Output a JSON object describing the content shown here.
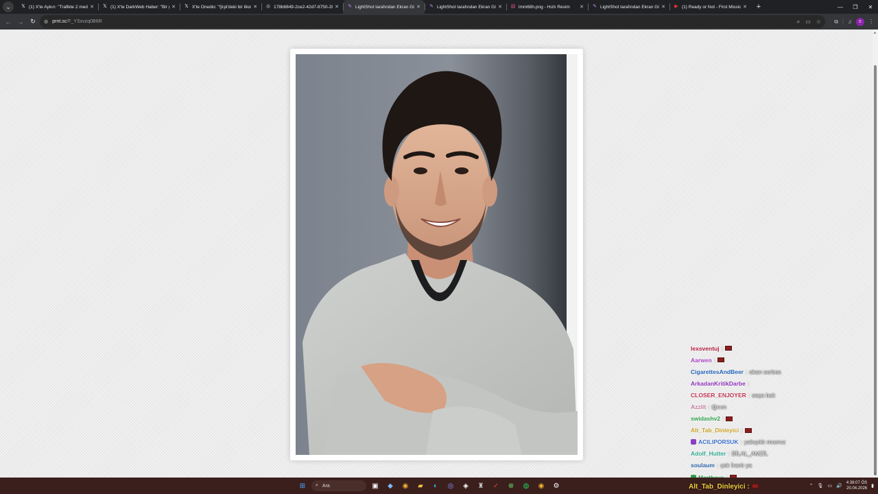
{
  "tabs": [
    {
      "title": "(1) X'te Aykırı: \"Trafikte 2 meden",
      "icon": "x"
    },
    {
      "title": "(1) X'te DarkWeb Haber: \"Bir gü",
      "icon": "x"
    },
    {
      "title": "X'te Onedio: \"Şişli'deki bir ilkok",
      "icon": "x"
    },
    {
      "title": "178b6849-2ce2-42d7-8750-28",
      "icon": "globe"
    },
    {
      "title": "LightShot tarafından Ekran Gö",
      "icon": "feather",
      "active": true
    },
    {
      "title": "LightShot tarafından Ekran Gö",
      "icon": "feather"
    },
    {
      "title": "lmm68h.png - Hızlı Resim",
      "icon": "image"
    },
    {
      "title": "LightShot tarafından Ekran Gö",
      "icon": "feather"
    },
    {
      "title": "(1) Ready or Not - First Mission",
      "icon": "youtube"
    }
  ],
  "address": {
    "host": "prnt.sc",
    "path": "/F_YSxvzq0B6R"
  },
  "chat": [
    {
      "user": "lexsventuj",
      "color": "#b0183b",
      "sep": ":",
      "msg": "",
      "flag": true
    },
    {
      "user": "Aarwen",
      "color": "#a83fc4",
      "sep": ":",
      "msg": "",
      "flag": true
    },
    {
      "user": "CigarettesAndBeer",
      "color": "#1f5fb5",
      "sep": ":",
      "msg": "okan serbes",
      "flag": false
    },
    {
      "user": "ArkadanKritikDarbe",
      "color": "#8a2fb8",
      "sep": ":",
      "msg": "",
      "flag": false
    },
    {
      "user": "CLOSER_ENJOYER",
      "color": "#c0304e",
      "sep": ":",
      "msg": "saça bak",
      "flag": false
    },
    {
      "user": "Azzlit",
      "color": "#c07a9a",
      "sep": ":",
      "msg": "iğrııın",
      "flag": false
    },
    {
      "user": "swidashv2",
      "color": "#2f9e4a",
      "sep": ":",
      "msg": "",
      "flag": true
    },
    {
      "user": "Alt_Tab_Dinleyici",
      "color": "#c8a020",
      "sep": ":",
      "msg": "",
      "flag": true
    },
    {
      "user": "ACILIPORSUK",
      "color": "#3b6fd0",
      "sep": ":",
      "msg": "yakışıklı mısınız",
      "flag": false,
      "badge": "#8a3fc4"
    },
    {
      "user": "Adolf_Hutter",
      "color": "#2fa890",
      "sep": ":",
      "msg": "BİLAL_AMZİL",
      "flag": false
    },
    {
      "user": "soulaum",
      "color": "#2a5fa8",
      "sep": ":",
      "msg": "çok İranlı ya",
      "flag": false
    },
    {
      "user": "Marthava",
      "color": "#2f9e4a",
      "sep": ":",
      "msg": "",
      "flag": true,
      "badge": "#2f9e4a"
    }
  ],
  "overlay_bottom": "Alt_Tab_Dinleyici :",
  "taskbar": {
    "search_placeholder": "Ara"
  },
  "clock": {
    "time": "4:38:07 ÖS",
    "date": "20.04.2026"
  }
}
